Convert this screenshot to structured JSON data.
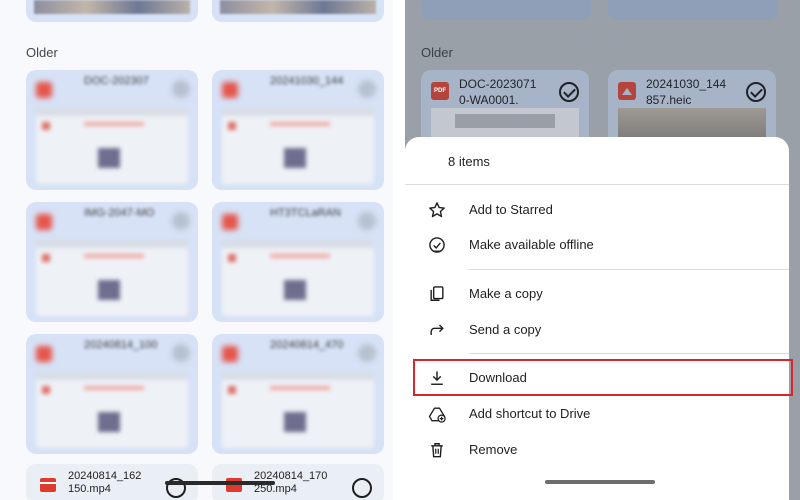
{
  "left_panel": {
    "section_label": "Older",
    "cards": [
      {
        "name": "DOC-202307"
      },
      {
        "name": "20241030_144"
      },
      {
        "name": "IMG-2047-MO"
      },
      {
        "name": "HT3TCLaRAN"
      },
      {
        "name": "20240814_100"
      },
      {
        "name": "20240814_470"
      }
    ],
    "bottom_cards": [
      {
        "name_line1": "20240814_162",
        "name_line2": "150.mp4"
      },
      {
        "name_line1": "20240814_170",
        "name_line2": "250.mp4"
      }
    ]
  },
  "right_panel": {
    "section_label": "Older",
    "cards": [
      {
        "type_icon": "pdf-icon",
        "type_text": "PDF",
        "name_line1": "DOC-2023071",
        "name_line2": "0-WA0001."
      },
      {
        "type_icon": "image-icon",
        "name_line1": "20241030_144",
        "name_line2": "857.heic"
      }
    ]
  },
  "sheet": {
    "title": "8 items",
    "items": [
      {
        "icon": "star-icon",
        "label": "Add to Starred"
      },
      {
        "icon": "offline-check-icon",
        "label": "Make available offline"
      },
      {
        "icon": "copy-icon",
        "label": "Make a copy"
      },
      {
        "icon": "send-icon",
        "label": "Send a copy"
      },
      {
        "icon": "download-icon",
        "label": "Download"
      },
      {
        "icon": "add-shortcut-icon",
        "label": "Add shortcut to Drive"
      },
      {
        "icon": "trash-icon",
        "label": "Remove"
      }
    ],
    "highlight_color": "#d9262e"
  }
}
